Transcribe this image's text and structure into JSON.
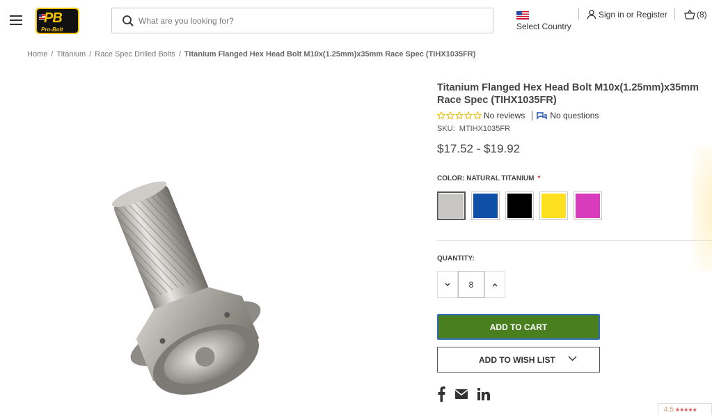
{
  "header": {
    "logo_text": "PB",
    "logo_subtext": "Pro-Bolt",
    "search_placeholder": "What are you looking for?",
    "country_label": "Select Country",
    "account_label": "Sign in or Register",
    "cart_count": "(8)"
  },
  "breadcrumb": {
    "items": [
      "Home",
      "Titanium",
      "Race Spec Drilled Bolts"
    ],
    "current": "Titanium Flanged Hex Head Bolt M10x(1.25mm)x35mm Race Spec (TIHX1035FR)"
  },
  "product": {
    "title": "Titanium Flanged Hex Head Bolt M10x(1.25mm)x35mm Race Spec (TIHX1035FR)",
    "reviews_label": "No reviews",
    "questions_label": "No questions",
    "rating": 0,
    "rating_max": 5,
    "sku_label": "SKU:",
    "sku_value": "MTIHX1035FR",
    "price": "$17.52 - $19.92",
    "color_label": "COLOR: NATURAL TITANIUM",
    "color_required_mark": "*",
    "colors": [
      {
        "name": "Natural Titanium",
        "hex": "#c8c6c2",
        "selected": true
      },
      {
        "name": "Blue",
        "hex": "#0f4fa8",
        "selected": false
      },
      {
        "name": "Black",
        "hex": "#000000",
        "selected": false
      },
      {
        "name": "Yellow",
        "hex": "#fde020",
        "selected": false
      },
      {
        "name": "Pink",
        "hex": "#d93bbd",
        "selected": false
      }
    ],
    "quantity_label": "QUANTITY:",
    "quantity": "8",
    "add_to_cart_label": "ADD TO CART",
    "wishlist_label": "ADD TO WISH LIST"
  },
  "social": [
    "facebook-icon",
    "email-icon",
    "linkedin-icon"
  ],
  "review_badge": {
    "score": "4.5",
    "stars": "★★★★★"
  },
  "colors": {
    "accent_green": "#4a7f1f",
    "focus_blue": "#2e6fb5",
    "star_outline": "#e6b800"
  }
}
